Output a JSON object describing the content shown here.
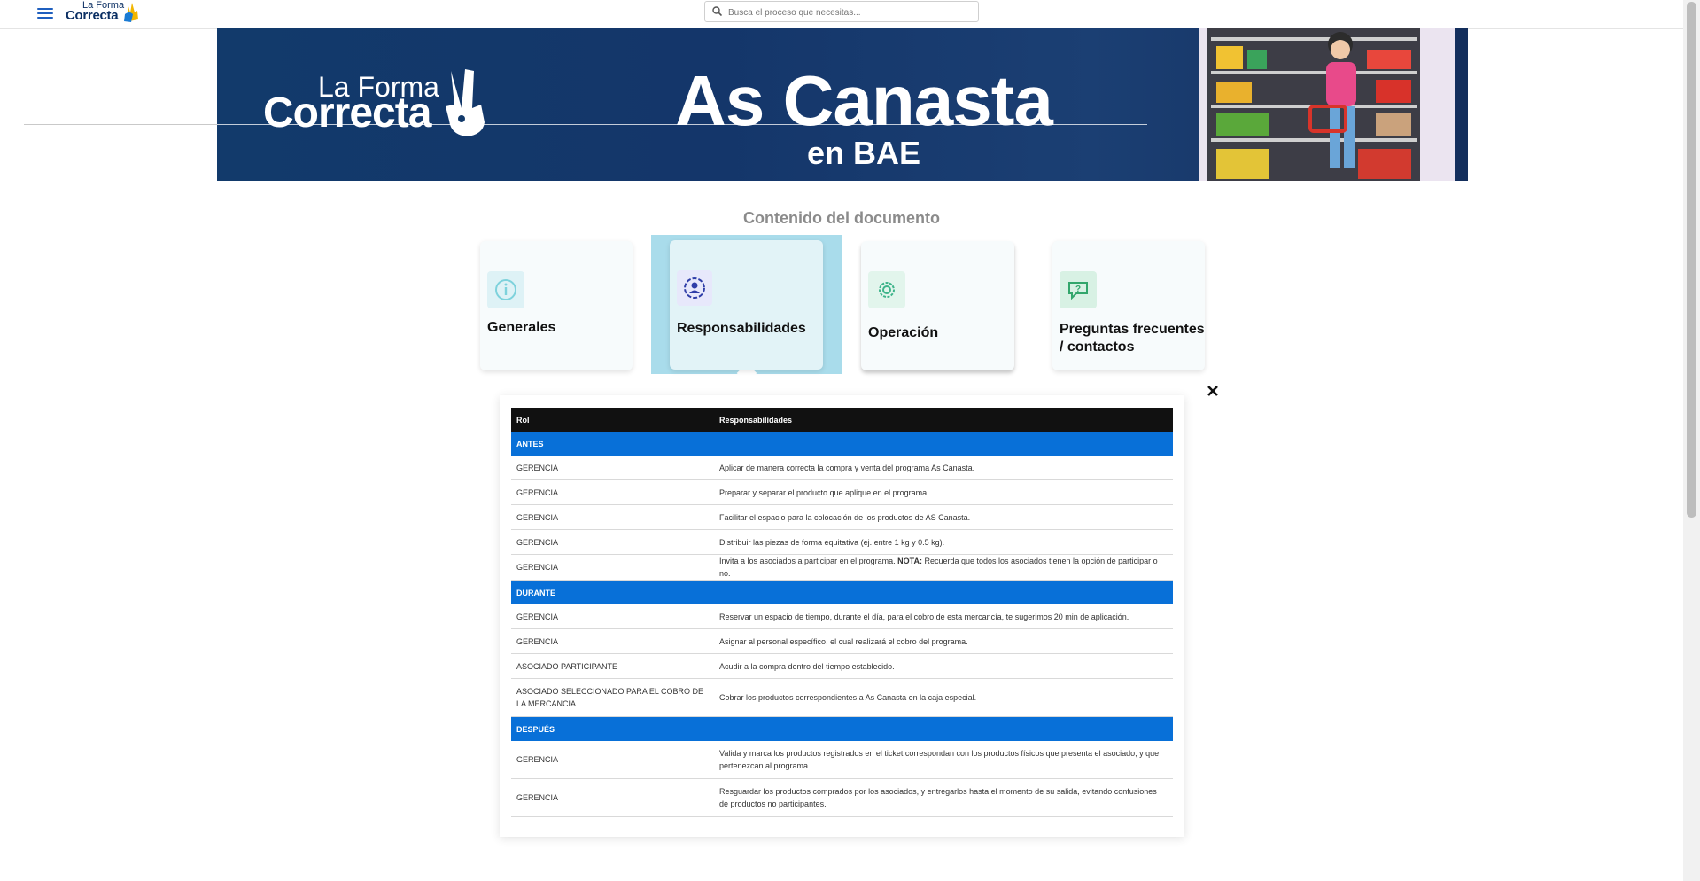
{
  "header": {
    "logo_top": "La Forma",
    "logo_bottom": "Correcta",
    "search_placeholder": "Busca el proceso que necesitas..."
  },
  "banner": {
    "logo_top": "La Forma",
    "logo_bottom": "Correcta",
    "title": "As Canasta",
    "subtitle": "en BAE"
  },
  "content": {
    "title": "Contenido del documento",
    "cards": [
      {
        "label": "Generales",
        "icon": "info-icon"
      },
      {
        "label": "Responsabilidades",
        "icon": "people-icon",
        "active": true
      },
      {
        "label": "Operación",
        "icon": "gear-icon"
      },
      {
        "label": "Preguntas frecuentes / contactos",
        "icon": "chat-question-icon"
      }
    ]
  },
  "table": {
    "headers": {
      "rol": "Rol",
      "resp": "Responsabilidades"
    },
    "sections": [
      {
        "phase": "ANTES",
        "rows": [
          {
            "rol": "GERENCIA",
            "resp": "Aplicar de manera correcta la compra y venta del programa As Canasta."
          },
          {
            "rol": "GERENCIA",
            "resp": "Preparar y separar el producto que aplique en el programa."
          },
          {
            "rol": "GERENCIA",
            "resp": "Facilitar el espacio para la colocación de los productos de AS Canasta."
          },
          {
            "rol": "GERENCIA",
            "resp": "Distribuir las piezas de forma equitativa (ej. entre 1 kg y 0.5 kg)."
          },
          {
            "rol": "GERENCIA",
            "resp_pre": "Invita a los asociados a participar en el programa. ",
            "resp_bold": "NOTA:",
            "resp_post": " Recuerda que todos los asociados tienen la opción de participar o no."
          }
        ]
      },
      {
        "phase": "DURANTE",
        "rows": [
          {
            "rol": "GERENCIA",
            "resp": "Reservar un espacio de tiempo, durante el día, para el cobro de esta mercancía, te sugerimos 20 min de aplicación."
          },
          {
            "rol": "GERENCIA",
            "resp": "Asignar al personal específico, el cual realizará el cobro del programa."
          },
          {
            "rol": "ASOCIADO PARTICIPANTE",
            "resp": "Acudir a la compra dentro del tiempo establecido."
          },
          {
            "rol": "ASOCIADO SELECCIONADO PARA EL COBRO DE LA MERCANCIA",
            "resp": "Cobrar los productos correspondientes a As Canasta en la caja especial."
          }
        ]
      },
      {
        "phase": "DESPUÉS",
        "rows": [
          {
            "rol": "GERENCIA",
            "resp": "Valida y marca los productos registrados en el ticket correspondan con los productos físicos que presenta el asociado, y que pertenezcan al programa."
          },
          {
            "rol": "GERENCIA",
            "resp": "Resguardar los productos comprados por los asociados, y entregarlos hasta el momento de su salida, evitando confusiones de productos no participantes."
          }
        ]
      }
    ]
  },
  "colors": {
    "banner_bg": "#14366a",
    "phase_blue": "#0870d8",
    "header_black": "#111111",
    "active_card_bg": "#a9dceb"
  }
}
